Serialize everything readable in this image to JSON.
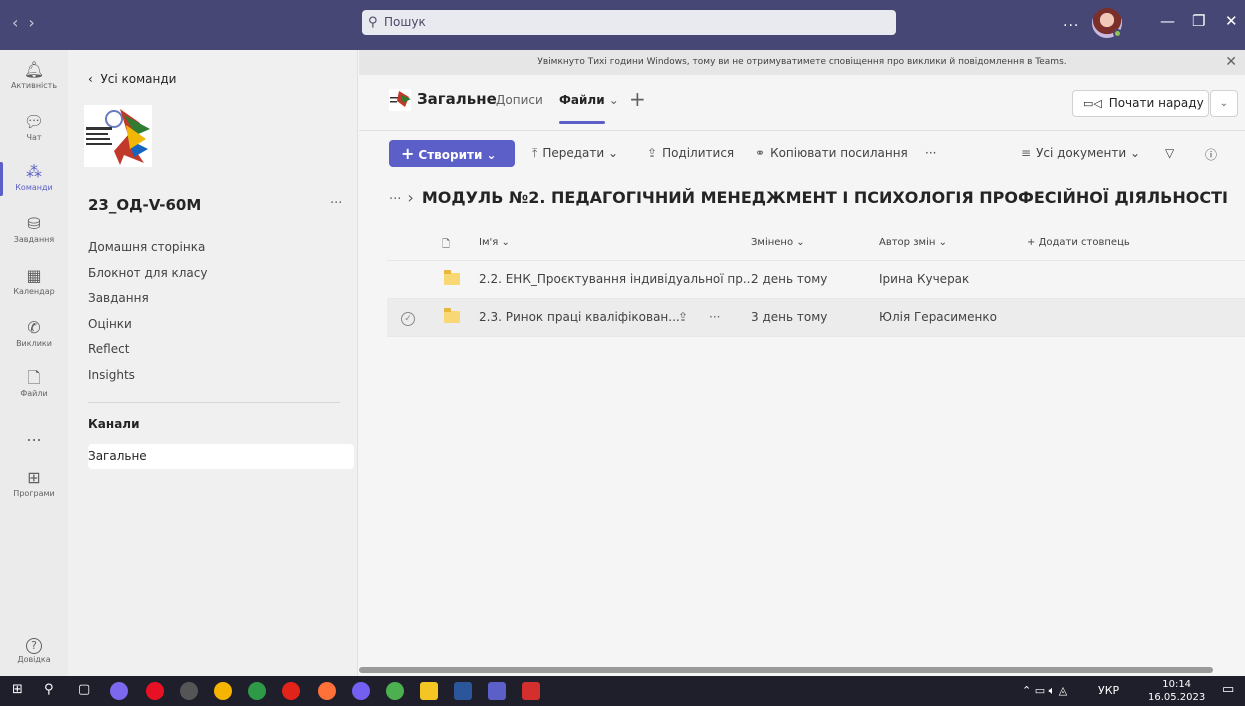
{
  "window": {
    "search_placeholder": "Пошук",
    "more": "...",
    "minimize": "—",
    "restore": "❐",
    "close": "✕"
  },
  "rail": {
    "items": [
      {
        "label": "Активність",
        "icon": "bell-icon",
        "glyph": "🔔︎"
      },
      {
        "label": "Чат",
        "icon": "chat-icon",
        "glyph": "💬︎"
      },
      {
        "label": "Команди",
        "icon": "teams-icon",
        "glyph": "⁂"
      },
      {
        "label": "Завдання",
        "icon": "assignments-icon",
        "glyph": "⛁"
      },
      {
        "label": "Календар",
        "icon": "calendar-icon",
        "glyph": "▦"
      },
      {
        "label": "Виклики",
        "icon": "phone-icon",
        "glyph": "✆"
      },
      {
        "label": "Файли",
        "icon": "file-icon",
        "glyph": "🗋"
      },
      {
        "label": "...",
        "icon": "more-icon",
        "glyph": ""
      },
      {
        "label": "Програми",
        "icon": "apps-icon",
        "glyph": "⊞"
      },
      {
        "label": "Довідка",
        "icon": "help-icon",
        "glyph": "?"
      }
    ]
  },
  "team_panel": {
    "back_label": "Усі команди",
    "team_name": "23_ОД-V-60М",
    "team_more": "···",
    "nav": [
      "Домашня сторінка",
      "Блокнот для класу",
      "Завдання",
      "Оцінки",
      "Reflect",
      "Insights"
    ],
    "channels_heading": "Канали",
    "active_channel": "Загальне"
  },
  "banner": {
    "text": "Увімкнуто Тихі години Windows, тому ви не отримуватимете сповіщення про виклики й повідомлення в Teams."
  },
  "channel": {
    "title": "Загальне",
    "tabs": [
      "Дописи",
      "Файли"
    ],
    "meet_label": "Почати нараду"
  },
  "toolbar": {
    "create": "Створити",
    "upload": "Передати",
    "share": "Поділитися",
    "copy_link": "Копіювати посилання",
    "more": "···",
    "view": "Усі документи"
  },
  "breadcrumb": {
    "dots": "···",
    "current": "МОДУЛЬ №2. ПЕДАГОГІЧНИЙ МЕНЕДЖМЕНТ І ПСИХОЛОГІЯ ПРОФЕСІЙНОЇ ДІЯЛЬНОСТІ"
  },
  "files": {
    "columns": {
      "name": "Ім'я",
      "modified": "Змінено",
      "author": "Автор змін",
      "add": "Додати стовпець"
    },
    "rows": [
      {
        "name": "2.2. ЕНК_Проєктування індивідуальної пр...",
        "modified": "2 день тому",
        "author": "Ірина Кучерак"
      },
      {
        "name": "2.3. Ринок праці кваліфікован...",
        "modified": "3 день тому",
        "author": "Юлія Герасименко"
      }
    ],
    "row_more": "···"
  },
  "taskbar": {
    "lang": "УКР",
    "time": "10:14",
    "date": "16.05.2023"
  },
  "colors": {
    "titlebar": "#464775",
    "accent": "#5b5fc7"
  }
}
